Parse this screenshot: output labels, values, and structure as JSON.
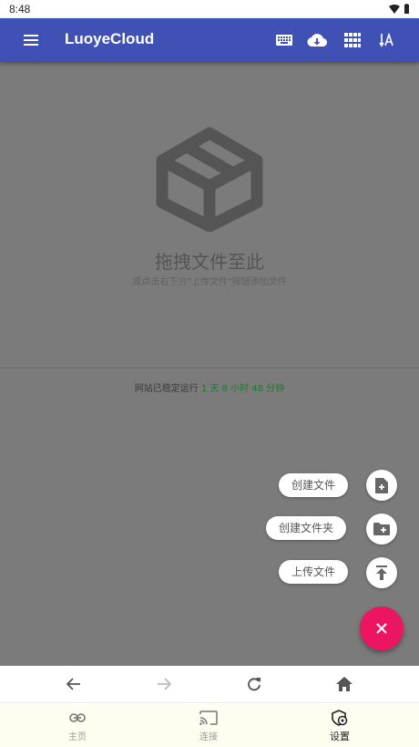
{
  "status_bar": {
    "time": "8:48"
  },
  "app_bar": {
    "title": "LuoyeCloud",
    "actions": [
      "keyboard-icon",
      "cloud-download-icon",
      "grid-view-icon",
      "sort-icon"
    ]
  },
  "content": {
    "drop_title": "拖拽文件至此",
    "drop_subtitle": "或点击右下方\"上传文件\"按钮添加文件",
    "uptime_prefix": "网站已稳定运行",
    "uptime_value": "1 天 8 小时 48 分钟"
  },
  "fab_menu": {
    "items": [
      {
        "label": "创建文件",
        "icon": "new-file-icon"
      },
      {
        "label": "创建文件夹",
        "icon": "new-folder-icon"
      },
      {
        "label": "上传文件",
        "icon": "upload-icon"
      }
    ],
    "close_icon": "close-icon"
  },
  "browser_nav": [
    "back-arrow-icon",
    "forward-arrow-icon",
    "refresh-icon",
    "home-icon"
  ],
  "tabs": [
    {
      "label": "主页",
      "icon": "link-icon"
    },
    {
      "label": "连接",
      "icon": "cast-icon"
    },
    {
      "label": "设置",
      "icon": "shield-settings-icon"
    }
  ],
  "colors": {
    "primary": "#3f51b5",
    "accent": "#ec1561",
    "uptime_green": "#1f7a2e"
  }
}
